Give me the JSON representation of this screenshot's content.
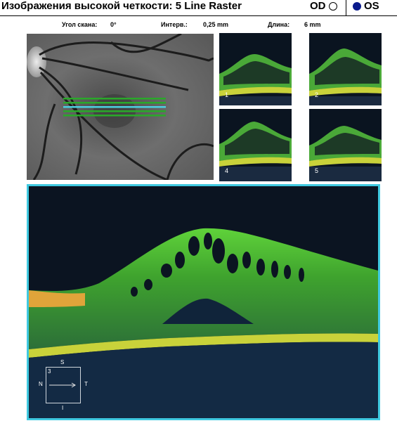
{
  "header": {
    "title": "Изображения высокой четкости: 5 Line Raster",
    "od_label": "OD",
    "os_label": "OS",
    "selected_eye": "OS"
  },
  "params": {
    "scan_angle_label": "Угол скана:",
    "scan_angle_value": "0°",
    "spacing_label": "Интерв.:",
    "spacing_value": "0,25 mm",
    "length_label": "Длина:",
    "length_value": "6 mm"
  },
  "thumbnails": [
    {
      "label": "1"
    },
    {
      "label": "2"
    },
    {
      "label": "4"
    },
    {
      "label": "5"
    }
  ],
  "orientation": {
    "top": "S",
    "bottom": "I",
    "left": "N",
    "right": "T",
    "line_number": "3"
  },
  "colors": {
    "accent_frame": "#3fc9e0",
    "raster_line": "#2aa82a",
    "selected_line": "#4ad0e0",
    "radio_fill": "#0a1a8c"
  }
}
